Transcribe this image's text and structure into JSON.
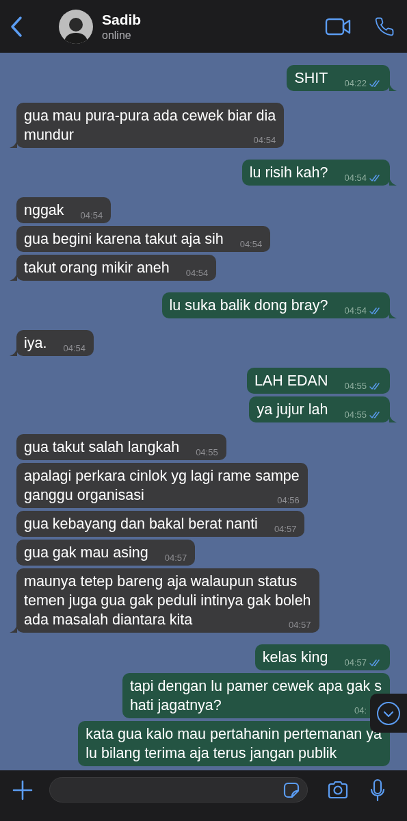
{
  "header": {
    "name": "Sadib",
    "status": "online"
  },
  "groups": [
    {
      "kind": "outgoing",
      "messages": [
        {
          "lines": [
            "SHIT"
          ],
          "time": "04:22",
          "ticks": true,
          "tail": true
        }
      ]
    },
    {
      "kind": "incoming",
      "messages": [
        {
          "lines": [
            "gua mau pura-pura ada cewek biar dia",
            "mundur"
          ],
          "time": "04:54",
          "tail": true
        }
      ]
    },
    {
      "kind": "outgoing",
      "messages": [
        {
          "lines": [
            "lu risih kah?"
          ],
          "time": "04:54",
          "ticks": true,
          "tail": true
        }
      ]
    },
    {
      "kind": "incoming",
      "messages": [
        {
          "lines": [
            "nggak"
          ],
          "time": "04:54",
          "tail": false
        },
        {
          "lines": [
            "gua begini karena takut aja sih"
          ],
          "time": "04:54",
          "tail": false
        },
        {
          "lines": [
            "takut orang mikir aneh"
          ],
          "time": "04:54",
          "tail": true
        }
      ]
    },
    {
      "kind": "outgoing",
      "messages": [
        {
          "lines": [
            "lu suka balik dong bray?"
          ],
          "time": "04:54",
          "ticks": true,
          "tail": true
        }
      ]
    },
    {
      "kind": "incoming",
      "messages": [
        {
          "lines": [
            "iya."
          ],
          "time": "04:54",
          "tail": true
        }
      ]
    },
    {
      "kind": "outgoing",
      "messages": [
        {
          "lines": [
            "LAH EDAN"
          ],
          "time": "04:55",
          "ticks": true,
          "tail": false
        },
        {
          "lines": [
            "ya jujur lah"
          ],
          "time": "04:55",
          "ticks": true,
          "tail": true
        }
      ]
    },
    {
      "kind": "incoming",
      "messages": [
        {
          "lines": [
            "gua takut salah langkah"
          ],
          "time": "04:55",
          "tail": false
        },
        {
          "lines": [
            "apalagi perkara cinlok yg lagi rame sampe",
            "ganggu organisasi"
          ],
          "time": "04:56",
          "tail": false
        },
        {
          "lines": [
            "gua kebayang dan bakal berat nanti"
          ],
          "time": "04:57",
          "tail": false
        },
        {
          "lines": [
            "gua gak mau asing"
          ],
          "time": "04:57",
          "tail": false
        },
        {
          "lines": [
            "maunya tetep bareng aja walaupun status",
            "temen juga gua gak peduli intinya gak boleh",
            "ada masalah diantara kita"
          ],
          "time": "04:57",
          "tail": true
        }
      ]
    },
    {
      "kind": "outgoing",
      "messages": [
        {
          "lines": [
            "kelas king"
          ],
          "time": "04:57",
          "ticks": true,
          "tail": false
        },
        {
          "lines": [
            "tapi dengan lu pamer cewek apa gak s",
            "hati jagatnya?"
          ],
          "time": "04:",
          "tail": false
        },
        {
          "lines": [
            "kata gua kalo mau pertahanin pertemanan ya",
            "lu bilang terima aja terus jangan publik"
          ],
          "tail": false
        }
      ]
    }
  ]
}
